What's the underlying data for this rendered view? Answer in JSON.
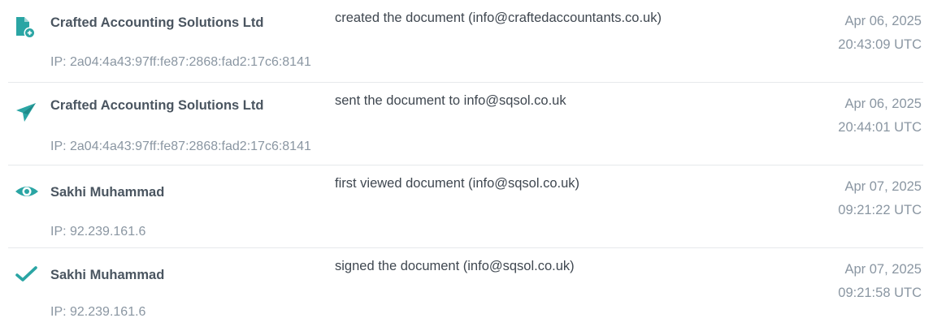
{
  "colors": {
    "icon_accent": "#2aa5a4",
    "text_primary": "#4a5560",
    "text_muted": "#8a96a2"
  },
  "entries": [
    {
      "icon": "document-add-icon",
      "actor": "Crafted Accounting Solutions Ltd",
      "ip": "IP: 2a04:4a43:97ff:fe87:2868:fad2:17c6:8141",
      "action": "created the document (info@craftedaccountants.co.uk)",
      "date": "Apr 06, 2025",
      "time": "20:43:09 UTC"
    },
    {
      "icon": "paper-plane-icon",
      "actor": "Crafted Accounting Solutions Ltd",
      "ip": "IP: 2a04:4a43:97ff:fe87:2868:fad2:17c6:8141",
      "action": "sent the document to info@sqsol.co.uk",
      "date": "Apr 06, 2025",
      "time": "20:44:01 UTC"
    },
    {
      "icon": "eye-icon",
      "actor": "Sakhi Muhammad",
      "ip": "IP: 92.239.161.6",
      "action": "first viewed document (info@sqsol.co.uk)",
      "date": "Apr 07, 2025",
      "time": "09:21:22 UTC"
    },
    {
      "icon": "checkmark-icon",
      "actor": "Sakhi Muhammad",
      "ip": "IP: 92.239.161.6",
      "action": "signed the document (info@sqsol.co.uk)",
      "date": "Apr 07, 2025",
      "time": "09:21:58 UTC"
    }
  ]
}
